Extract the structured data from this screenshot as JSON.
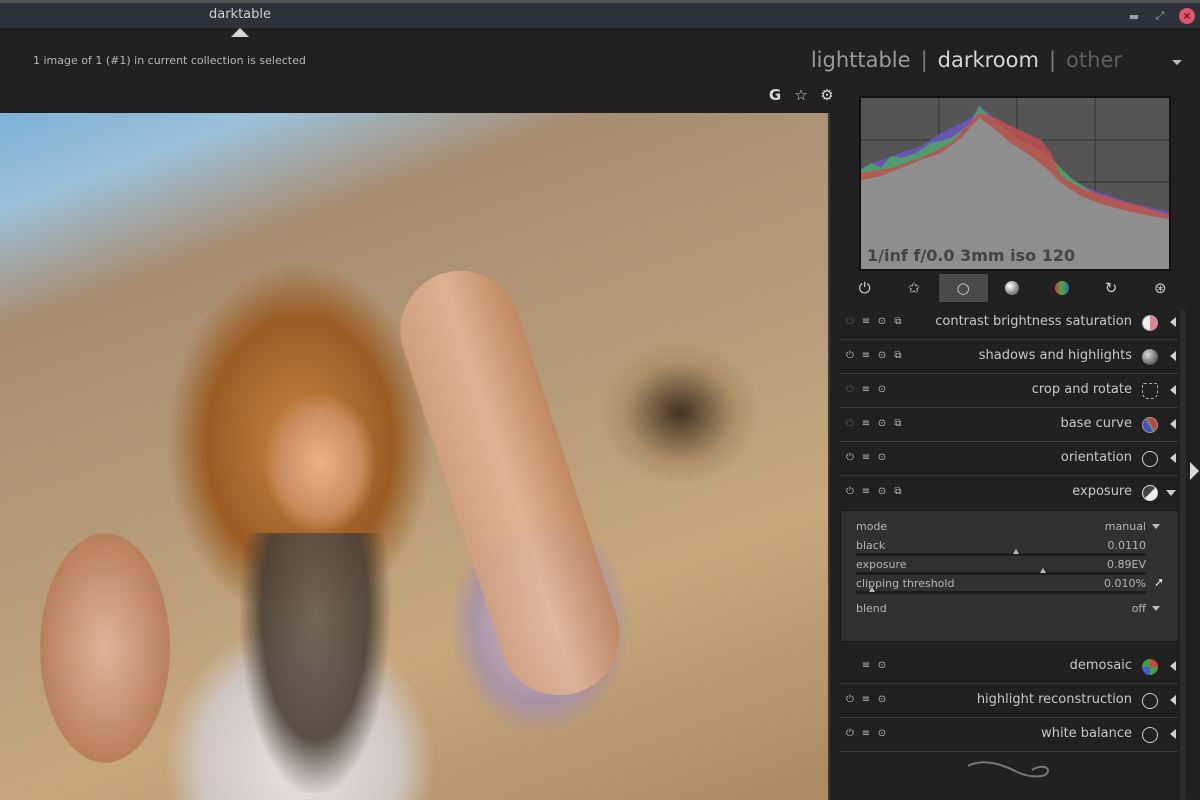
{
  "window": {
    "title": "darktable",
    "minimize_icon": "minimize-icon",
    "maximize_icon": "maximize-icon",
    "close_icon": "close-icon",
    "minimize_glyph": "▬",
    "maximize_glyph": "⤢",
    "close_glyph": "×"
  },
  "header": {
    "status": "1 image of 1 (#1) in current collection is selected",
    "views": [
      {
        "label": "lighttable",
        "state": "normal"
      },
      {
        "label": "darkroom",
        "state": "active"
      },
      {
        "label": "other",
        "state": "dim"
      }
    ],
    "separator": "|"
  },
  "toolbar": {
    "icons": [
      {
        "name": "grouping-icon",
        "glyph": "G"
      },
      {
        "name": "star-icon",
        "glyph": "☆"
      },
      {
        "name": "gear-icon",
        "glyph": "⚙"
      }
    ]
  },
  "histogram": {
    "exif": "1/inf f/0.0 3mm iso 120"
  },
  "module_groups": [
    {
      "name": "active-modules-icon",
      "glyph": "⏻",
      "active": false
    },
    {
      "name": "favorites-icon",
      "glyph": "✩",
      "active": false
    },
    {
      "name": "basic-group-icon",
      "glyph": "○",
      "active": true
    },
    {
      "name": "tone-group-icon",
      "glyph": "◐",
      "active": false
    },
    {
      "name": "color-group-icon",
      "glyph": "●",
      "active": false
    },
    {
      "name": "correct-group-icon",
      "glyph": "↻",
      "active": false
    },
    {
      "name": "effects-group-icon",
      "glyph": "⊛",
      "active": false
    }
  ],
  "modules": [
    {
      "label": "contrast brightness saturation",
      "enabled": false,
      "multi": true,
      "icon": "contrast-icon",
      "expanded": false
    },
    {
      "label": "shadows and highlights",
      "enabled": true,
      "multi": true,
      "icon": "sphere-icon",
      "expanded": false
    },
    {
      "label": "crop and rotate",
      "enabled": false,
      "multi": false,
      "icon": "crop-icon",
      "expanded": false
    },
    {
      "label": "base curve",
      "enabled": false,
      "multi": true,
      "icon": "curve-icon",
      "expanded": false
    },
    {
      "label": "orientation",
      "enabled": true,
      "multi": false,
      "icon": "rotate-icon",
      "expanded": false
    },
    {
      "label": "exposure",
      "enabled": true,
      "multi": true,
      "icon": "exposure-icon",
      "expanded": true
    },
    {
      "label": "demosaic",
      "enabled": null,
      "multi": false,
      "icon": "demosaic-icon",
      "expanded": false
    },
    {
      "label": "highlight reconstruction",
      "enabled": true,
      "multi": false,
      "icon": "highlight-icon",
      "expanded": false
    },
    {
      "label": "white balance",
      "enabled": true,
      "multi": false,
      "icon": "thermometer-icon",
      "expanded": false
    }
  ],
  "exposure": {
    "mode_label": "mode",
    "mode_value": "manual",
    "black_label": "black",
    "black_value": "0.0110",
    "black_position": 0.55,
    "exposure_label": "exposure",
    "exposure_value": "0.89EV",
    "exposure_position": 0.645,
    "clipping_label": "clipping threshold",
    "clipping_value": "0.010%",
    "clipping_position": 0.055,
    "blend_label": "blend",
    "blend_value": "off",
    "picker_glyph": "➚"
  },
  "module_ctl_glyphs": {
    "power": "⏻",
    "presets": "≡",
    "reset": "⊙",
    "multi": "⧉"
  }
}
